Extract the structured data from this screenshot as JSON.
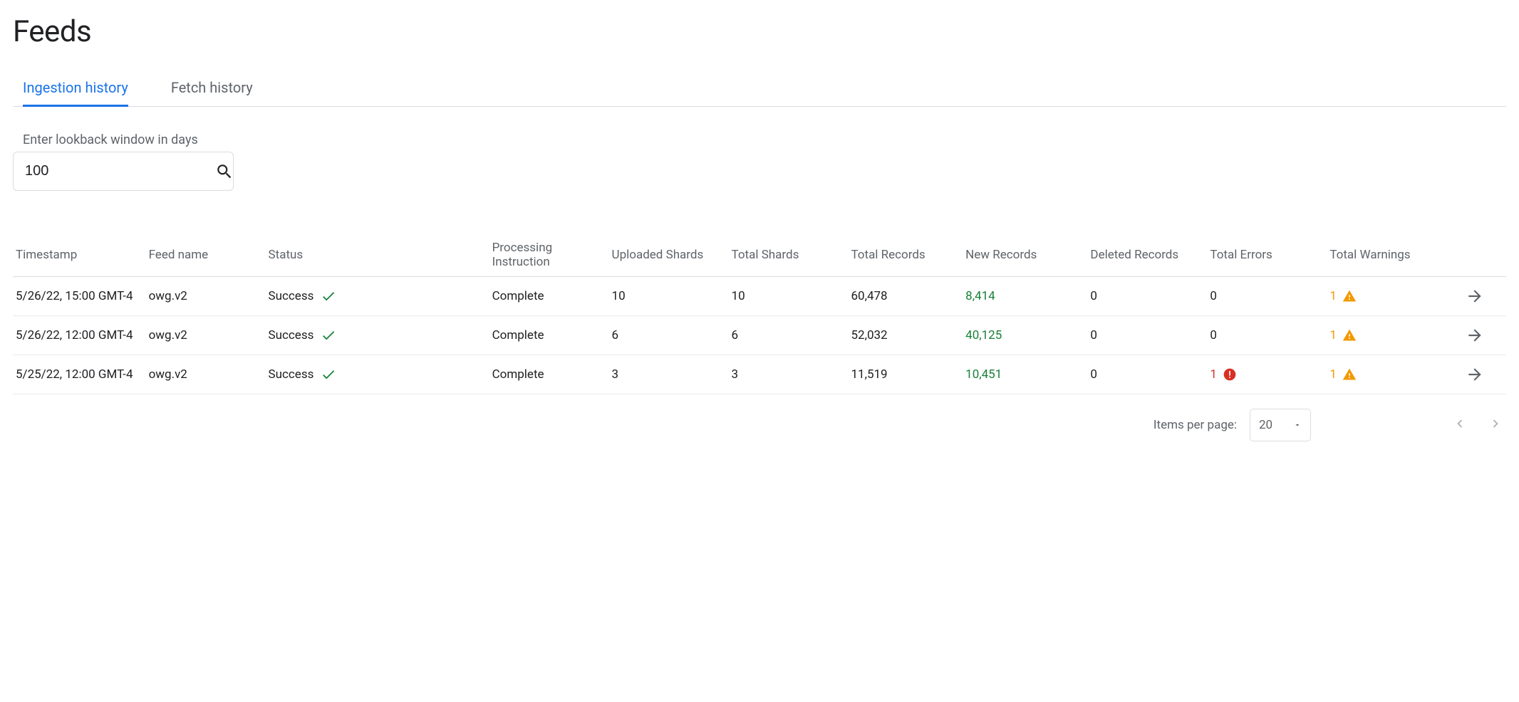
{
  "page": {
    "title": "Feeds"
  },
  "tabs": [
    {
      "label": "Ingestion history",
      "active": true
    },
    {
      "label": "Fetch history",
      "active": false
    }
  ],
  "lookback": {
    "label": "Enter lookback window in days",
    "value": "100"
  },
  "columns": {
    "timestamp": "Timestamp",
    "feed_name": "Feed name",
    "status": "Status",
    "processing_instruction": "Processing Instruction",
    "uploaded_shards": "Uploaded Shards",
    "total_shards": "Total Shards",
    "total_records": "Total Records",
    "new_records": "New Records",
    "deleted_records": "Deleted Records",
    "total_errors": "Total Errors",
    "total_warnings": "Total Warnings"
  },
  "rows": [
    {
      "timestamp": "5/26/22, 15:00 GMT-4",
      "feed_name": "owg.v2",
      "status": "Success",
      "processing_instruction": "Complete",
      "uploaded_shards": "10",
      "total_shards": "10",
      "total_records": "60,478",
      "new_records": "8,414",
      "deleted_records": "0",
      "total_errors": "0",
      "has_error_icon": false,
      "total_warnings": "1",
      "has_warning_icon": true
    },
    {
      "timestamp": "5/26/22, 12:00 GMT-4",
      "feed_name": "owg.v2",
      "status": "Success",
      "processing_instruction": "Complete",
      "uploaded_shards": "6",
      "total_shards": "6",
      "total_records": "52,032",
      "new_records": "40,125",
      "deleted_records": "0",
      "total_errors": "0",
      "has_error_icon": false,
      "total_warnings": "1",
      "has_warning_icon": true
    },
    {
      "timestamp": "5/25/22, 12:00 GMT-4",
      "feed_name": "owg.v2",
      "status": "Success",
      "processing_instruction": "Complete",
      "uploaded_shards": "3",
      "total_shards": "3",
      "total_records": "11,519",
      "new_records": "10,451",
      "deleted_records": "0",
      "total_errors": "1",
      "has_error_icon": true,
      "total_warnings": "1",
      "has_warning_icon": true
    }
  ],
  "pager": {
    "items_per_page_label": "Items per page:",
    "items_per_page_value": "20"
  },
  "icons": {
    "search": "search-icon",
    "check": "check-icon",
    "warning": "warning-icon",
    "error": "error-icon",
    "arrow_right": "arrow-right-icon",
    "chevron_left": "chevron-left-icon",
    "chevron_right": "chevron-right-icon",
    "dropdown": "dropdown-icon"
  }
}
